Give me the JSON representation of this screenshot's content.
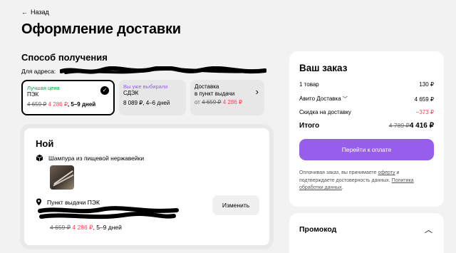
{
  "nav": {
    "back_label": "Назад"
  },
  "page": {
    "title": "Оформление доставки"
  },
  "delivery": {
    "section_title": "Способ получения",
    "address_label": "Для адреса:",
    "options": [
      {
        "tag": "Лучшая цена",
        "name": "ПЭК",
        "old_price": "4 659 ₽",
        "new_price": "4 286 ₽",
        "days": ", 5–9 дней",
        "selected": true
      },
      {
        "tag": "Вы уже выбирали",
        "name": "СДЭК",
        "price": "8 089 ₽, 4–6 дней",
        "selected": false
      },
      {
        "name_line1": "Доставка",
        "name_line2": "в пункт выдачи",
        "prefix": "от ",
        "old_price": "4 659 ₽",
        "new_price": "4 286 ₽",
        "selected": false
      }
    ]
  },
  "shipment": {
    "recipient": "Ной",
    "item_name": "Шампура из пищевой нержавейки",
    "pickup_label": "Пункт выдачи ПЭК",
    "old_price": "4 659 ₽",
    "new_price": "4 286 ₽",
    "days": ", 5–9 дней",
    "change_label": "Изменить"
  },
  "order": {
    "title": "Ваш заказ",
    "items_label": "1 товар",
    "items_value": "130 ₽",
    "delivery_label": "Авито Доставка",
    "delivery_value": "4 659 ₽",
    "discount_label": "Скидка на доставку",
    "discount_value": "−373 ₽",
    "total_label": "Итого",
    "total_old": "4 789 ₽",
    "total_value": "4 416 ₽",
    "pay_label": "Перейти к оплате",
    "disclaimer_1": "Оплачивая заказ, вы принимаете ",
    "disclaimer_link1": "оферту",
    "disclaimer_2": " и подтверждаете достоверность данных.",
    "disclaimer_link2": "Политика обработки данных",
    "disclaimer_3": "."
  },
  "promo": {
    "title": "Промокод"
  },
  "colors": {
    "accent": "#965eeb",
    "sale": "#ff4053",
    "best": "#02a443",
    "bg": "#f2f2f2"
  }
}
